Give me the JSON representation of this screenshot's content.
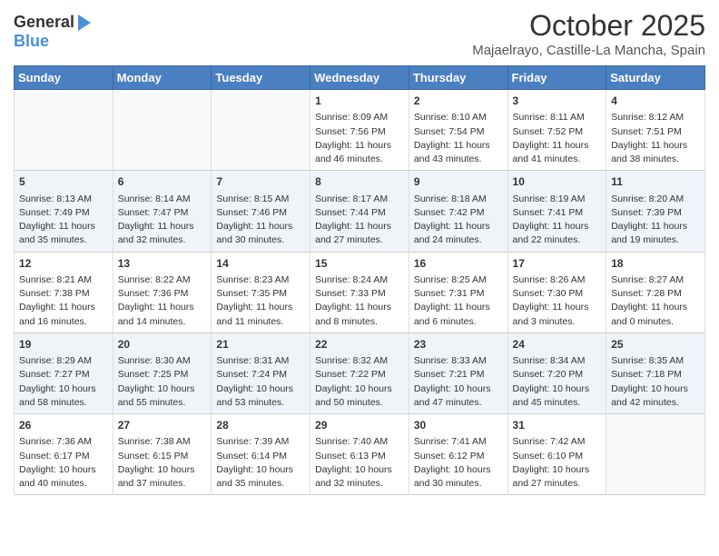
{
  "logo": {
    "general": "General",
    "blue": "Blue"
  },
  "header": {
    "month": "October 2025",
    "location": "Majaelrayo, Castille-La Mancha, Spain"
  },
  "days_of_week": [
    "Sunday",
    "Monday",
    "Tuesday",
    "Wednesday",
    "Thursday",
    "Friday",
    "Saturday"
  ],
  "weeks": [
    [
      {
        "day": "",
        "content": ""
      },
      {
        "day": "",
        "content": ""
      },
      {
        "day": "",
        "content": ""
      },
      {
        "day": "1",
        "content": "Sunrise: 8:09 AM\nSunset: 7:56 PM\nDaylight: 11 hours and 46 minutes."
      },
      {
        "day": "2",
        "content": "Sunrise: 8:10 AM\nSunset: 7:54 PM\nDaylight: 11 hours and 43 minutes."
      },
      {
        "day": "3",
        "content": "Sunrise: 8:11 AM\nSunset: 7:52 PM\nDaylight: 11 hours and 41 minutes."
      },
      {
        "day": "4",
        "content": "Sunrise: 8:12 AM\nSunset: 7:51 PM\nDaylight: 11 hours and 38 minutes."
      }
    ],
    [
      {
        "day": "5",
        "content": "Sunrise: 8:13 AM\nSunset: 7:49 PM\nDaylight: 11 hours and 35 minutes."
      },
      {
        "day": "6",
        "content": "Sunrise: 8:14 AM\nSunset: 7:47 PM\nDaylight: 11 hours and 32 minutes."
      },
      {
        "day": "7",
        "content": "Sunrise: 8:15 AM\nSunset: 7:46 PM\nDaylight: 11 hours and 30 minutes."
      },
      {
        "day": "8",
        "content": "Sunrise: 8:17 AM\nSunset: 7:44 PM\nDaylight: 11 hours and 27 minutes."
      },
      {
        "day": "9",
        "content": "Sunrise: 8:18 AM\nSunset: 7:42 PM\nDaylight: 11 hours and 24 minutes."
      },
      {
        "day": "10",
        "content": "Sunrise: 8:19 AM\nSunset: 7:41 PM\nDaylight: 11 hours and 22 minutes."
      },
      {
        "day": "11",
        "content": "Sunrise: 8:20 AM\nSunset: 7:39 PM\nDaylight: 11 hours and 19 minutes."
      }
    ],
    [
      {
        "day": "12",
        "content": "Sunrise: 8:21 AM\nSunset: 7:38 PM\nDaylight: 11 hours and 16 minutes."
      },
      {
        "day": "13",
        "content": "Sunrise: 8:22 AM\nSunset: 7:36 PM\nDaylight: 11 hours and 14 minutes."
      },
      {
        "day": "14",
        "content": "Sunrise: 8:23 AM\nSunset: 7:35 PM\nDaylight: 11 hours and 11 minutes."
      },
      {
        "day": "15",
        "content": "Sunrise: 8:24 AM\nSunset: 7:33 PM\nDaylight: 11 hours and 8 minutes."
      },
      {
        "day": "16",
        "content": "Sunrise: 8:25 AM\nSunset: 7:31 PM\nDaylight: 11 hours and 6 minutes."
      },
      {
        "day": "17",
        "content": "Sunrise: 8:26 AM\nSunset: 7:30 PM\nDaylight: 11 hours and 3 minutes."
      },
      {
        "day": "18",
        "content": "Sunrise: 8:27 AM\nSunset: 7:28 PM\nDaylight: 11 hours and 0 minutes."
      }
    ],
    [
      {
        "day": "19",
        "content": "Sunrise: 8:29 AM\nSunset: 7:27 PM\nDaylight: 10 hours and 58 minutes."
      },
      {
        "day": "20",
        "content": "Sunrise: 8:30 AM\nSunset: 7:25 PM\nDaylight: 10 hours and 55 minutes."
      },
      {
        "day": "21",
        "content": "Sunrise: 8:31 AM\nSunset: 7:24 PM\nDaylight: 10 hours and 53 minutes."
      },
      {
        "day": "22",
        "content": "Sunrise: 8:32 AM\nSunset: 7:22 PM\nDaylight: 10 hours and 50 minutes."
      },
      {
        "day": "23",
        "content": "Sunrise: 8:33 AM\nSunset: 7:21 PM\nDaylight: 10 hours and 47 minutes."
      },
      {
        "day": "24",
        "content": "Sunrise: 8:34 AM\nSunset: 7:20 PM\nDaylight: 10 hours and 45 minutes."
      },
      {
        "day": "25",
        "content": "Sunrise: 8:35 AM\nSunset: 7:18 PM\nDaylight: 10 hours and 42 minutes."
      }
    ],
    [
      {
        "day": "26",
        "content": "Sunrise: 7:36 AM\nSunset: 6:17 PM\nDaylight: 10 hours and 40 minutes."
      },
      {
        "day": "27",
        "content": "Sunrise: 7:38 AM\nSunset: 6:15 PM\nDaylight: 10 hours and 37 minutes."
      },
      {
        "day": "28",
        "content": "Sunrise: 7:39 AM\nSunset: 6:14 PM\nDaylight: 10 hours and 35 minutes."
      },
      {
        "day": "29",
        "content": "Sunrise: 7:40 AM\nSunset: 6:13 PM\nDaylight: 10 hours and 32 minutes."
      },
      {
        "day": "30",
        "content": "Sunrise: 7:41 AM\nSunset: 6:12 PM\nDaylight: 10 hours and 30 minutes."
      },
      {
        "day": "31",
        "content": "Sunrise: 7:42 AM\nSunset: 6:10 PM\nDaylight: 10 hours and 27 minutes."
      },
      {
        "day": "",
        "content": ""
      }
    ]
  ]
}
